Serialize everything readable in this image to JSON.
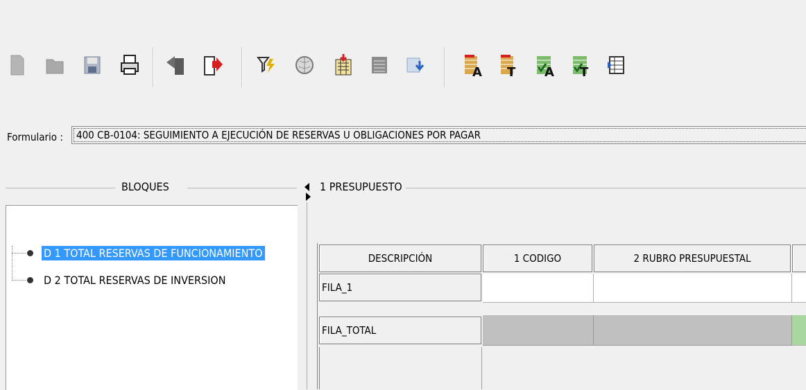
{
  "toolbar": {
    "buttons": [
      {
        "icon": "new-document-icon"
      },
      {
        "icon": "open-folder-icon"
      },
      {
        "icon": "save-disk-icon"
      },
      {
        "icon": "print-icon"
      },
      {
        "icon": "back-arrow-icon"
      },
      {
        "icon": "forward-arrow-icon"
      },
      {
        "icon": "filter-icon"
      },
      {
        "icon": "globe-icon"
      },
      {
        "icon": "import-icon"
      },
      {
        "icon": "grid-icon"
      },
      {
        "icon": "download-icon"
      },
      {
        "icon": "report-a-icon"
      },
      {
        "icon": "report-t-icon"
      },
      {
        "icon": "report-a-check-icon"
      },
      {
        "icon": "report-t-check-icon"
      },
      {
        "icon": "list-icon"
      }
    ]
  },
  "form": {
    "label": "Formulario :",
    "value": "400 CB-0104: SEGUIMIENTO A EJECUCIÓN DE RESERVAS U OBLIGACIONES POR PAGAR"
  },
  "bloques": {
    "title": "BLOQUES",
    "items": [
      {
        "label": "D 1 TOTAL RESERVAS DE FUNCIONAMIENTO",
        "selected": true
      },
      {
        "label": "D 2 TOTAL RESERVAS DE INVERSION",
        "selected": false
      }
    ]
  },
  "presupuesto": {
    "title": "1 PRESUPUESTO",
    "columns": [
      "DESCRIPCIÓN",
      "1 CODIGO",
      "2 RUBRO PRESUPUESTAL"
    ],
    "rows": [
      "FILA_1",
      "FILA_TOTAL"
    ]
  },
  "colors": {
    "selection": "#3399ff",
    "total_row": "#c0c0c0",
    "total_cell_highlight": "#a8d8a0"
  }
}
